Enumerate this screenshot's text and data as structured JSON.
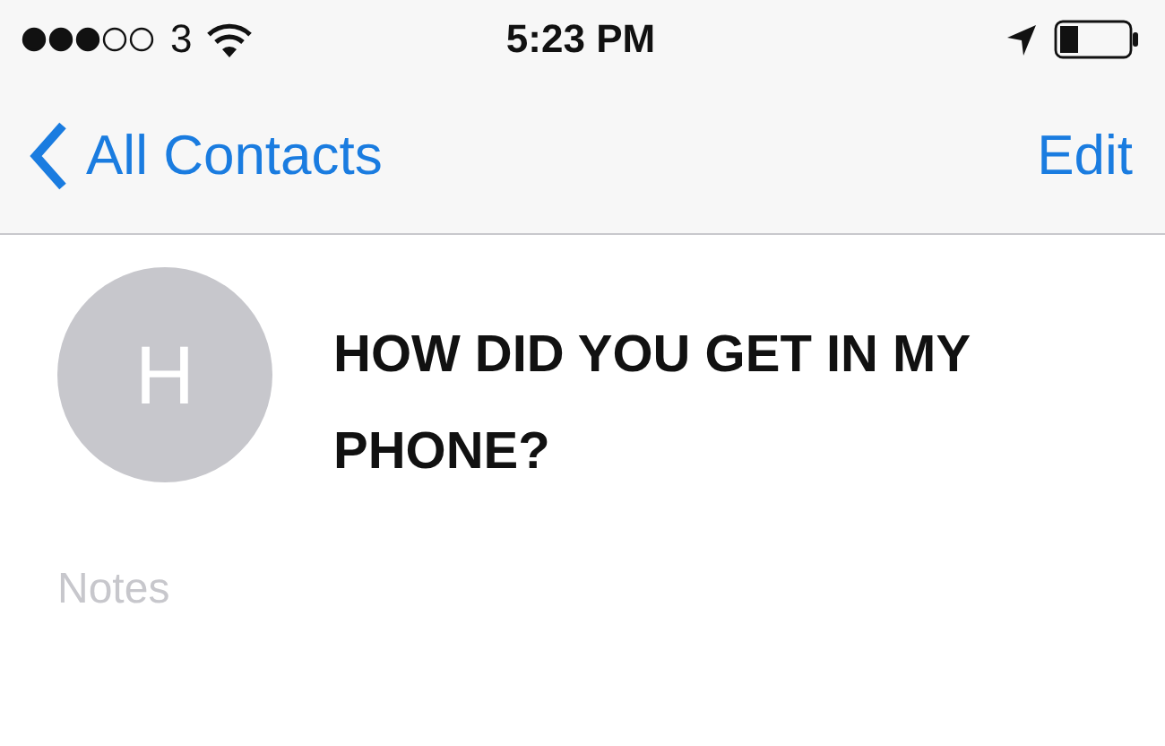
{
  "status_bar": {
    "carrier": "3",
    "time": "5:23 PM"
  },
  "nav_bar": {
    "back_label": "All Contacts",
    "action": "Edit"
  },
  "contact": {
    "initial": "H",
    "name": "HOW DID YOU GET IN MY PHONE?"
  },
  "notes": {
    "label": "Notes"
  }
}
